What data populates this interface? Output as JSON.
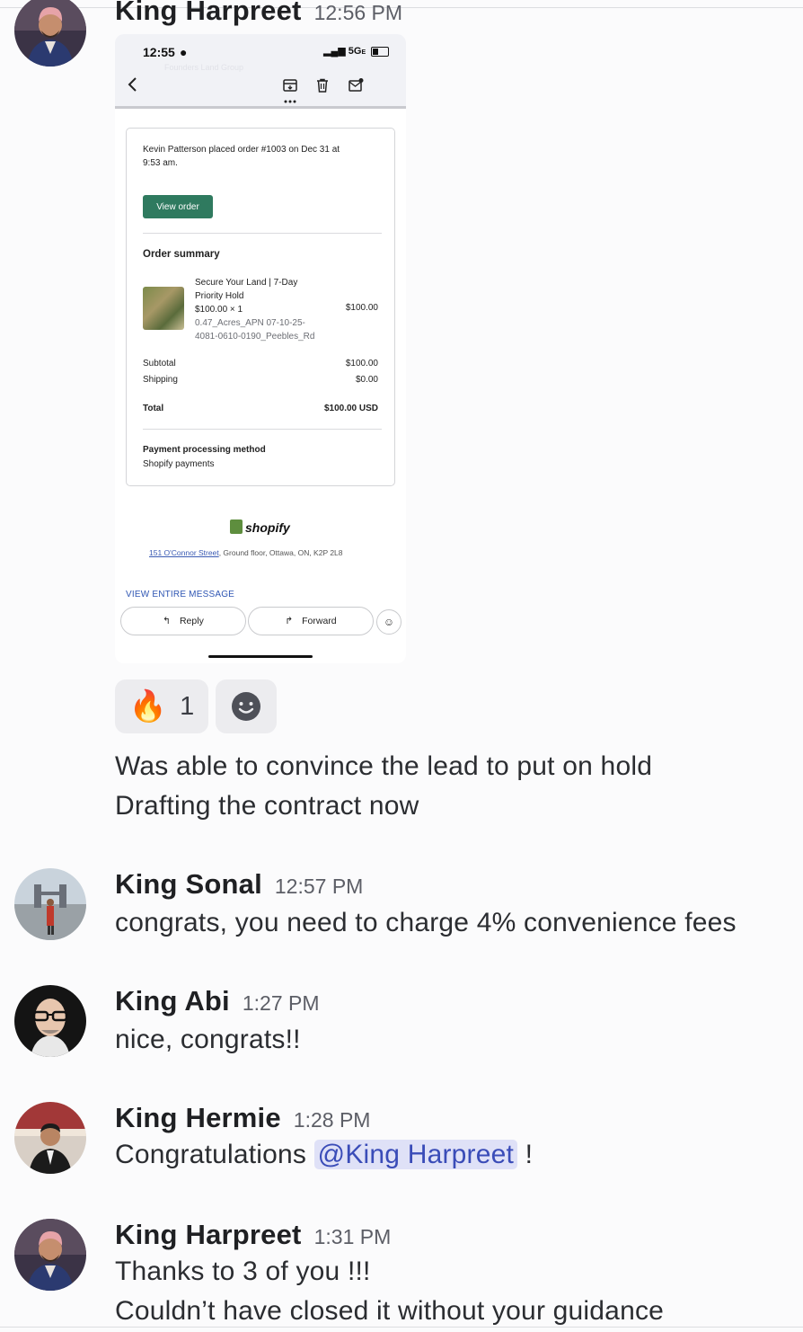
{
  "messages": [
    {
      "username": "King Harpreet",
      "time": "12:56 PM",
      "attachment": {
        "status_time": "12:55",
        "network": "5G",
        "network_suffix": "E",
        "faded_sender": "Founders Land Group",
        "order_line1": "Kevin Patterson placed order #1003 on Dec 31 at",
        "order_line2": "9:53 am.",
        "view_order_label": "View order",
        "order_summary_title": "Order summary",
        "item_title_1": "Secure Your Land | 7-Day",
        "item_title_2": "Priority Hold",
        "item_qty": "$100.00 × 1",
        "item_price": "$100.00",
        "item_variant_1": "0.47_Acres_APN 07-10-25-",
        "item_variant_2": "4081-0610-0190_Peebles_Rd",
        "subtotal_label": "Subtotal",
        "subtotal_value": "$100.00",
        "shipping_label": "Shipping",
        "shipping_value": "$0.00",
        "total_label": "Total",
        "total_value": "$100.00 USD",
        "payment_title": "Payment processing method",
        "payment_value": "Shopify payments",
        "brand": "shopify",
        "address_link": "151 O'Connor Street",
        "address_rest": ", Ground floor, Ottawa, ON, K2P 2L8",
        "view_entire": "VIEW ENTIRE MESSAGE",
        "reply_label": "Reply",
        "forward_label": "Forward"
      },
      "reactions": [
        {
          "emoji": "🔥",
          "count": "1"
        },
        {
          "emoji": "add-reaction-icon"
        }
      ],
      "lines": [
        "Was able to convince the lead to put on hold",
        "Drafting the contract now"
      ]
    },
    {
      "username": "King Sonal",
      "time": "12:57 PM",
      "lines": [
        "congrats, you need to charge 4% convenience fees"
      ]
    },
    {
      "username": "King Abi",
      "time": "1:27 PM",
      "lines": [
        "nice, congrats!!"
      ]
    },
    {
      "username": "King Hermie",
      "time": "1:28 PM",
      "text_before": "Congratulations ",
      "mention": "@King Harpreet",
      "text_after": " !"
    },
    {
      "username": "King Harpreet",
      "time": "1:31 PM",
      "lines": [
        "Thanks to 3 of you !!!",
        "Couldn’t have closed it without your guidance"
      ]
    }
  ],
  "colors": {
    "mention_bg": "#dfe1f7",
    "mention_text": "#3a4cb8",
    "view_order_bg": "#2f7a5f",
    "shopify_green": "#5e8e3e"
  }
}
